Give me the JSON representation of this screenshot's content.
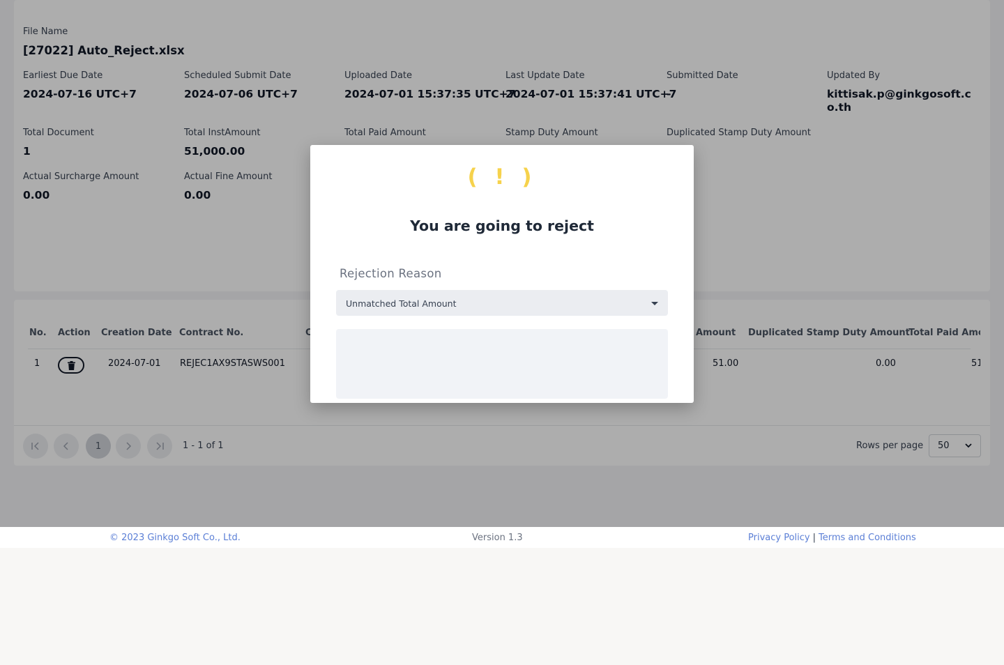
{
  "file": {
    "label": "File Name",
    "value": "[27022] Auto_Reject.xlsx"
  },
  "info_row1": [
    {
      "label": "Earliest Due Date",
      "value": "2024-07-16 UTC+7"
    },
    {
      "label": "Scheduled Submit Date",
      "value": "2024-07-06 UTC+7"
    },
    {
      "label": "Uploaded Date",
      "value": "2024-07-01 15:37:35 UTC+7"
    },
    {
      "label": "Last Update Date",
      "value": "2024-07-01 15:37:41 UTC+7"
    },
    {
      "label": "Submitted Date",
      "value": "-"
    },
    {
      "label": "Updated By",
      "value": "kittisak.p@ginkgosoft.co.th"
    }
  ],
  "info_row2": [
    {
      "label": "Total Document",
      "value": "1"
    },
    {
      "label": "Total InstAmount",
      "value": "51,000.00"
    },
    {
      "label": "Total Paid Amount",
      "value": ""
    },
    {
      "label": "Stamp Duty Amount",
      "value": ""
    },
    {
      "label": "Duplicated Stamp Duty Amount",
      "value": ""
    }
  ],
  "info_row3": [
    {
      "label": "Actual Surcharge Amount",
      "value": "0.00"
    },
    {
      "label": "Actual Fine Amount",
      "value": "0.00"
    }
  ],
  "table": {
    "headers": {
      "no": "No.",
      "action": "Action",
      "creation_date": "Creation Date",
      "contract_no": "Contract No.",
      "partial_c": "C",
      "stamp_amount": "Amount",
      "dup_stamp": "Duplicated Stamp Duty Amount",
      "total_paid": "Total Paid Amou"
    },
    "row": {
      "no": "1",
      "creation_date": "2024-07-01",
      "contract_no": "REJEC1AX9STASWS001",
      "stamp_amount": "51.00",
      "dup_stamp": "0.00",
      "total_paid": "51."
    }
  },
  "pager": {
    "first_icon": "first-page-icon",
    "prev_icon": "prev-page-icon",
    "current_page": "1",
    "next_icon": "next-page-icon",
    "last_icon": "last-page-icon",
    "range_text": "1 - 1 of 1",
    "rows_per_page_label": "Rows per page",
    "rows_per_page_value": "50"
  },
  "footer": {
    "copyright": "© 2023 Ginkgo Soft Co., Ltd.",
    "version": "Version 1.3",
    "privacy": "Privacy Policy",
    "separator": "|",
    "terms": "Terms and Conditions"
  },
  "modal": {
    "icon": "warning-icon",
    "icon_text": "( ! )",
    "title": "You are going to reject",
    "reason_label": "Rejection Reason",
    "reason_selected": "Unmatched Total Amount",
    "reason_text": ""
  },
  "colors": {
    "warning": "#f6d24c",
    "link": "#5b7fd6",
    "overlay": "rgba(0,0,0,0.32)"
  }
}
